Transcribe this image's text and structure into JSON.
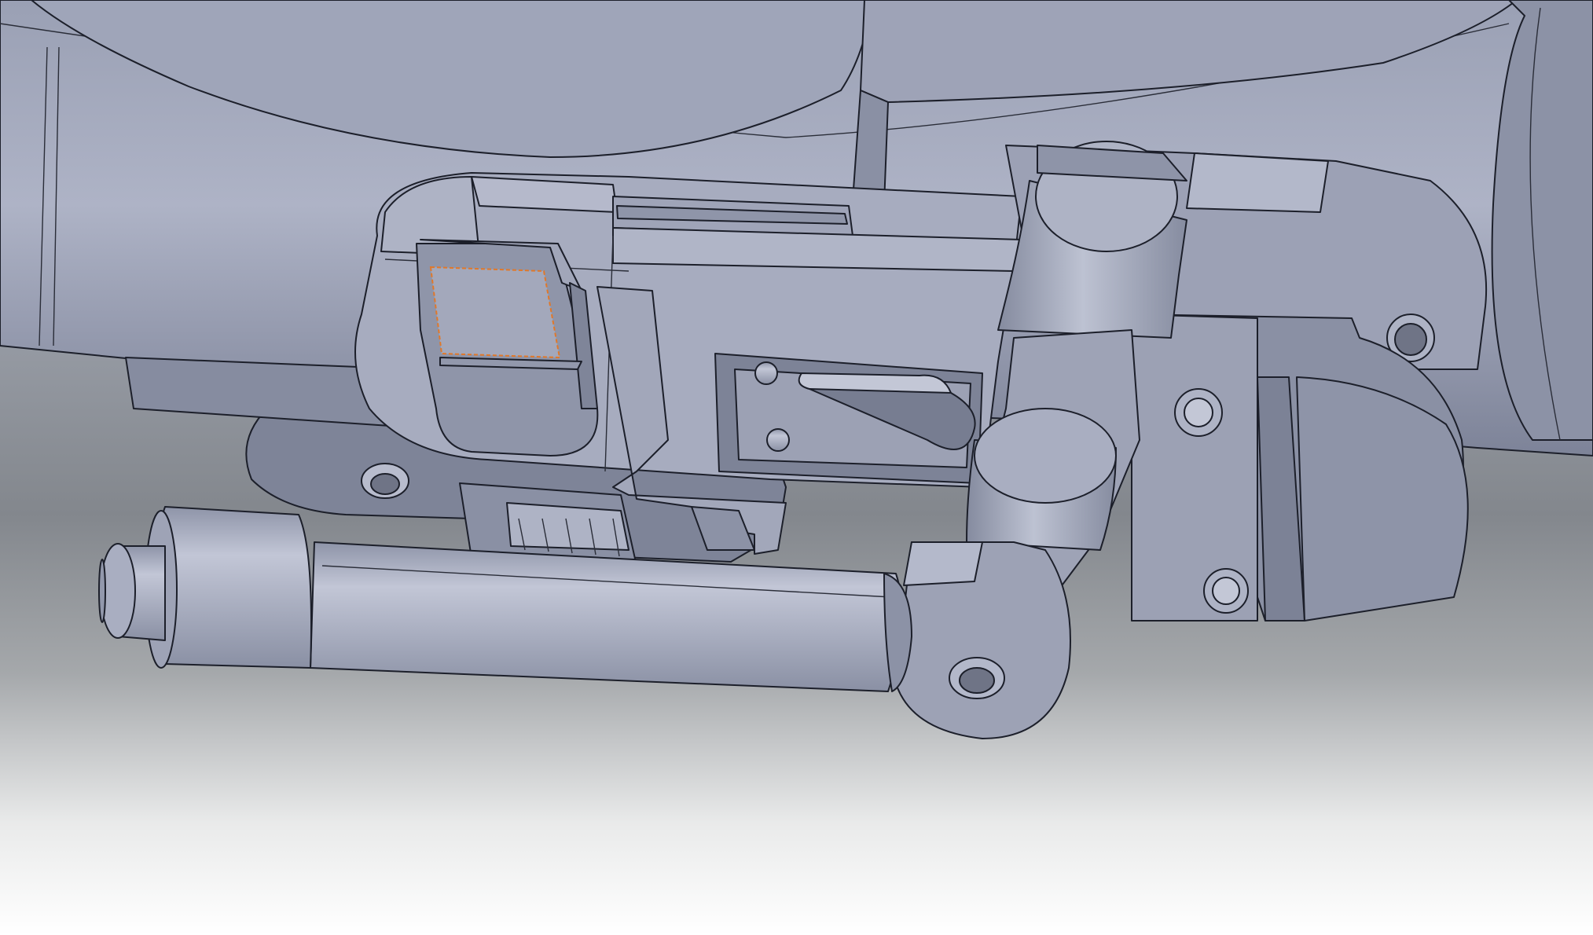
{
  "viewport": {
    "background_gradient": [
      "#8f96a4",
      "#83878d",
      "#ffffff"
    ],
    "part_colors": {
      "shadow": "#6f7486",
      "dark": "#858b9f",
      "mid": "#9da2b6",
      "light": "#b3b8cb",
      "highlight": "#c7cbdc",
      "edge": "#1c1f2a"
    },
    "selected_face_edge_color": "#e0782a"
  }
}
